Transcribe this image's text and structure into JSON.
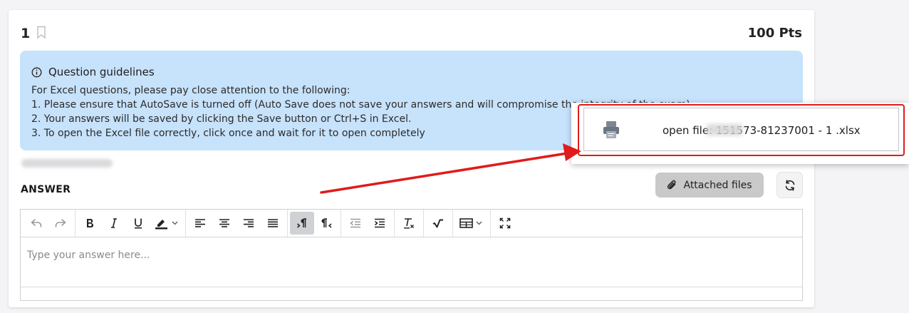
{
  "question": {
    "number": "1",
    "points": "100 Pts"
  },
  "guidelines": {
    "title": "Question guidelines",
    "lines": [
      "For Excel questions, please pay close attention to the following:",
      "1. Please ensure that AutoSave is turned off (Auto Save does not save your answers and will compromise the integrity of the exam)",
      "2. Your answers will be saved by clicking the Save button or Ctrl+S in Excel.",
      "3. To open the Excel file correctly, click once and wait for it to open completely"
    ]
  },
  "answer": {
    "label": "ANSWER",
    "attached_files_label": "Attached files",
    "placeholder": "Type your answer here..."
  },
  "attached_popup": {
    "file_label": "open file: 151573-81237001 - 1      .xlsx"
  },
  "toolbar": {
    "icons": [
      "undo-icon",
      "redo-icon",
      "bold-icon",
      "italic-icon",
      "underline-icon",
      "highlight-color-icon",
      "align-left-icon",
      "align-center-icon",
      "align-right-icon",
      "align-justify-icon",
      "ltr-icon",
      "rtl-icon",
      "outdent-icon",
      "indent-icon",
      "clear-format-icon",
      "math-icon",
      "table-icon",
      "fullscreen-icon"
    ]
  },
  "colors": {
    "guidelines_bg": "#c7e2fb",
    "annotation_red": "#e01b1b",
    "button_grey": "#c9c9c9",
    "active_tool": "#cfd1d5"
  }
}
